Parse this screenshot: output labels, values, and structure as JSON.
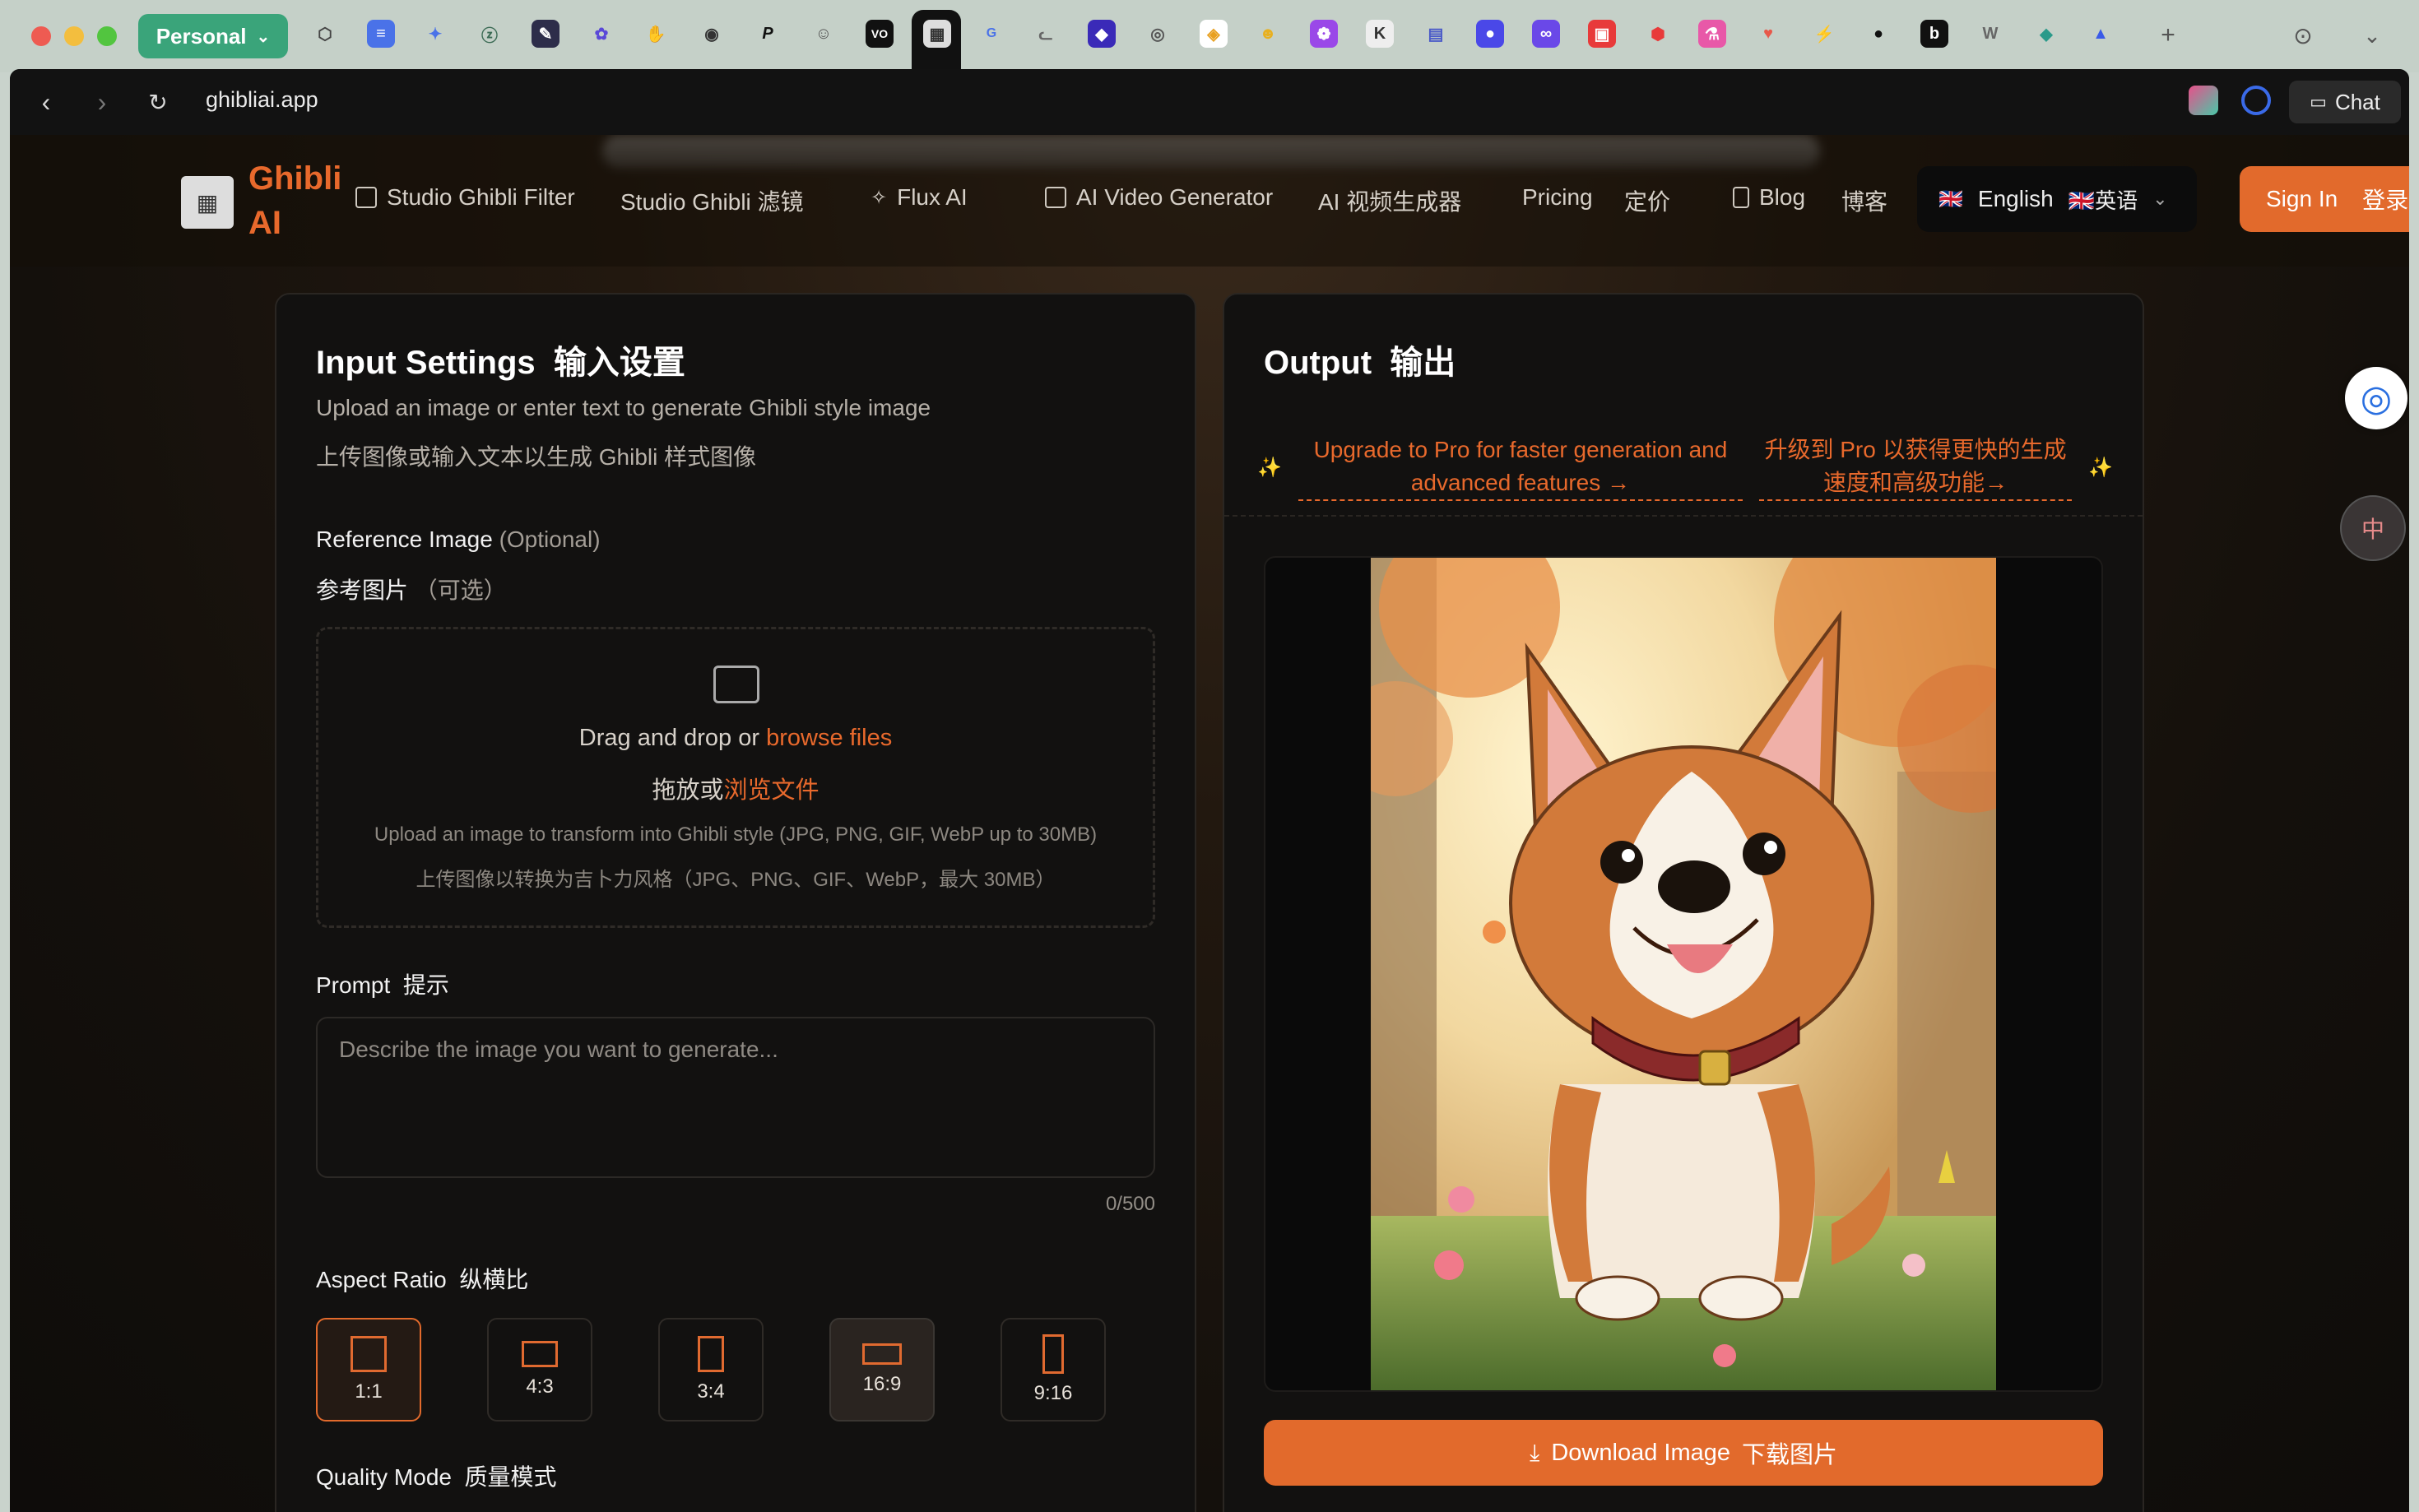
{
  "browser": {
    "profile_label": "Personal",
    "url": "ghibliai.app",
    "chat_label": "Chat"
  },
  "header": {
    "logo_text": "Ghibli AI",
    "nav": {
      "filter_en": "Studio Ghibli Filter",
      "filter_zh": "Studio Ghibli 滤镜",
      "flux": "Flux AI",
      "video_en": "AI Video Generator",
      "video_zh": "AI 视频生成器",
      "pricing_en": "Pricing",
      "pricing_zh": "定价",
      "blog_en": "Blog",
      "blog_zh": "博客"
    },
    "language": {
      "flag": "🇬🇧",
      "en": "English",
      "zh": "🇬🇧英语"
    },
    "signin_en": "Sign In",
    "signin_zh": "登录"
  },
  "input_panel": {
    "title_en": "Input Settings",
    "title_zh": "输入设置",
    "subtitle_en": "Upload an image or enter text to generate Ghibli style image",
    "subtitle_zh": "上传图像或输入文本以生成 Ghibli 样式图像",
    "ref_label_en": "Reference Image",
    "ref_optional_en": "(Optional)",
    "ref_label_zh": "参考图片",
    "ref_optional_zh": "（可选）",
    "dropzone": {
      "drag_en": "Drag and drop or ",
      "browse_en": "browse files",
      "drag_zh": "拖放或",
      "browse_zh": "浏览文件",
      "hint_en": "Upload an image to transform into Ghibli style (JPG, PNG, GIF, WebP up to 30MB)",
      "hint_zh": "上传图像以转换为吉卜力风格（JPG、PNG、GIF、WebP，最大 30MB）"
    },
    "prompt_label_en": "Prompt",
    "prompt_label_zh": "提示",
    "prompt_placeholder": "Describe the image you want to generate...",
    "prompt_counter": "0/500",
    "aspect_label_en": "Aspect Ratio",
    "aspect_label_zh": "纵横比",
    "aspect_options": [
      "1:1",
      "4:3",
      "3:4",
      "16:9",
      "9:16"
    ],
    "aspect_selected": "1:1",
    "quality_label_en": "Quality Mode",
    "quality_label_zh": "质量模式"
  },
  "output_panel": {
    "title_en": "Output",
    "title_zh": "输出",
    "promo_en": "Upgrade to Pro for faster generation and advanced features →",
    "promo_zh": "升级到 Pro 以获得更快的生成速度和高级功能→",
    "download_en": "Download Image",
    "download_zh": "下载图片"
  },
  "colors": {
    "accent": "#e26a2c",
    "panel_bg": "#121110",
    "page_bg": "#14100c"
  }
}
